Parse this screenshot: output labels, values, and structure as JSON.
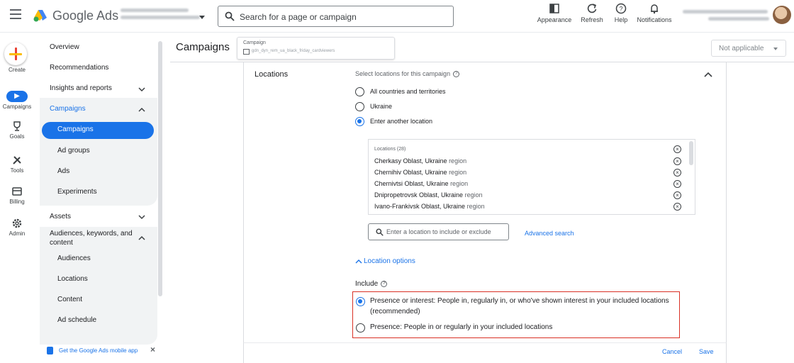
{
  "header": {
    "brand": "Google Ads",
    "search_placeholder": "Search for a page or campaign",
    "tools": [
      {
        "label": "Appearance",
        "icon": "appearance-icon"
      },
      {
        "label": "Refresh",
        "icon": "refresh-icon"
      },
      {
        "label": "Help",
        "icon": "help-icon"
      },
      {
        "label": "Notifications",
        "icon": "bell-icon"
      }
    ]
  },
  "rail": {
    "items": [
      {
        "label": "Create",
        "icon": "plus-icon"
      },
      {
        "label": "Campaigns",
        "icon": "megaphone-icon"
      },
      {
        "label": "Goals",
        "icon": "trophy-icon"
      },
      {
        "label": "Tools",
        "icon": "tools-icon"
      },
      {
        "label": "Billing",
        "icon": "card-icon"
      },
      {
        "label": "Admin",
        "icon": "gear-icon"
      }
    ]
  },
  "nav": {
    "overview": "Overview",
    "recommendations": "Recommendations",
    "insights": "Insights and reports",
    "campaigns_group": "Campaigns",
    "campaigns": "Campaigns",
    "ad_groups": "Ad groups",
    "ads": "Ads",
    "experiments": "Experiments",
    "assets": "Assets",
    "audiences_group": "Audiences, keywords, and content",
    "audiences": "Audiences",
    "locations": "Locations",
    "content": "Content",
    "ad_schedule": "Ad schedule",
    "mobile_app": "Get the Google Ads mobile app"
  },
  "page": {
    "title": "Campaigns",
    "campaign_label": "Campaign",
    "campaign_value": "gdn_dyn_rem_ua_black_friday_cardviewers",
    "not_applicable": "Not applicable"
  },
  "locations": {
    "section_title": "Locations",
    "prompt": "Select locations for this campaign",
    "options": [
      "All countries and territories",
      "Ukraine",
      "Enter another location"
    ],
    "list_header": "Locations (28)",
    "list": [
      {
        "name": "Cherkasy Oblast, Ukraine",
        "type": "region"
      },
      {
        "name": "Chernihiv Oblast, Ukraine",
        "type": "region"
      },
      {
        "name": "Chernivtsi Oblast, Ukraine",
        "type": "region"
      },
      {
        "name": "Dnipropetrovsk Oblast, Ukraine",
        "type": "region"
      },
      {
        "name": "Ivano-Frankivsk Oblast, Ukraine",
        "type": "region"
      }
    ],
    "input_placeholder": "Enter a location to include or exclude",
    "advanced_search": "Advanced search",
    "location_options": "Location options",
    "include_label": "Include",
    "include_options": [
      "Presence or interest: People in, regularly in, or who've shown interest in your included locations (recommended)",
      "Presence: People in or regularly in your included locations"
    ]
  },
  "footer": {
    "cancel": "Cancel",
    "save": "Save"
  },
  "colors": {
    "accent": "#1a73e8",
    "highlight": "#d93025"
  }
}
